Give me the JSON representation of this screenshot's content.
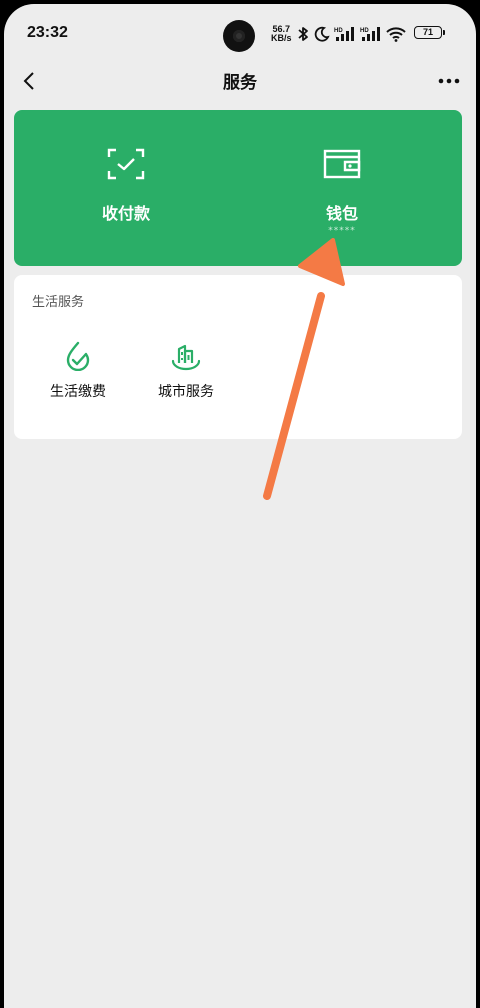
{
  "status_bar": {
    "time": "23:32",
    "net_speed_value": "56.7",
    "net_speed_unit": "KB/s",
    "battery": "71"
  },
  "nav": {
    "title": "服务"
  },
  "pay_card": {
    "color": "#2aae67",
    "items": [
      {
        "label": "收付款",
        "icon": "scan-check-icon"
      },
      {
        "label": "钱包",
        "sub": "*****",
        "icon": "wallet-icon"
      }
    ]
  },
  "life_services": {
    "title": "生活服务",
    "accent": "#2aae67",
    "items": [
      {
        "label": "生活缴费",
        "icon": "bill-payment-icon"
      },
      {
        "label": "城市服务",
        "icon": "city-services-icon"
      }
    ]
  },
  "annotation": {
    "color": "#f47a45"
  }
}
